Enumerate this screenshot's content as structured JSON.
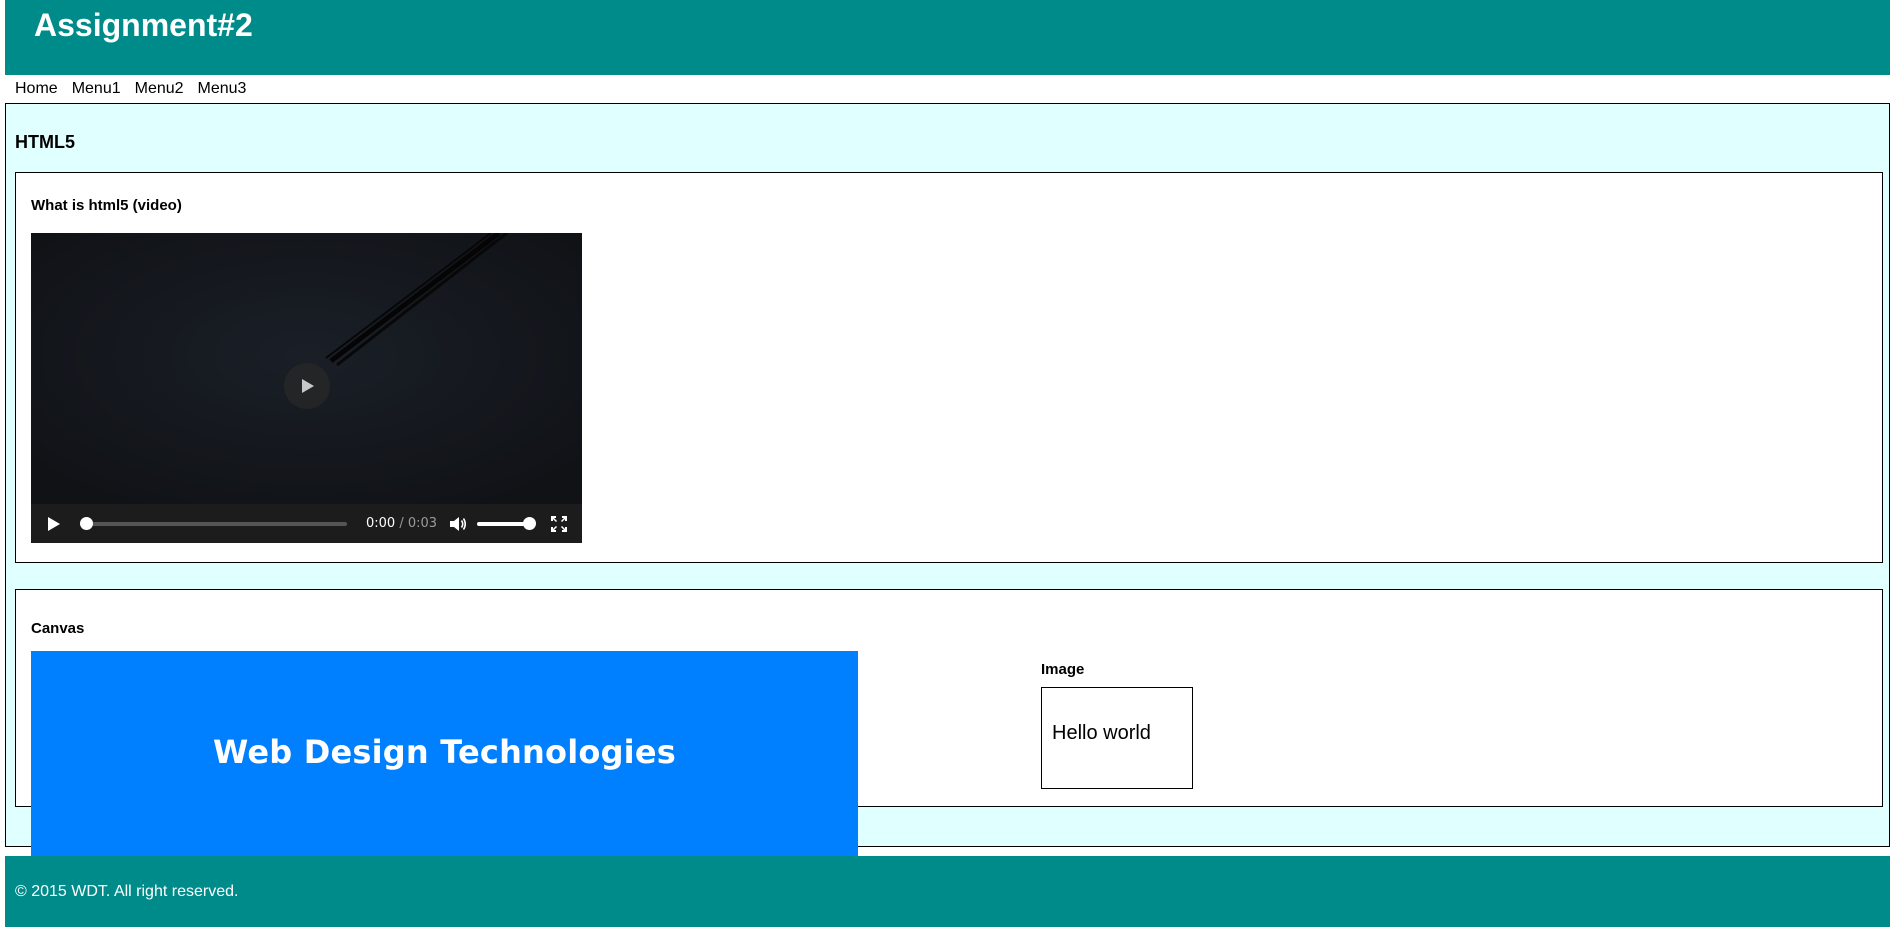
{
  "header": {
    "title": "Assignment#2"
  },
  "nav": {
    "items": [
      "Home",
      "Menu1",
      "Menu2",
      "Menu3"
    ]
  },
  "main": {
    "heading": "HTML5",
    "video_section": {
      "title": "What is html5 (video)",
      "player": {
        "current_time": "0:00",
        "separator": " / ",
        "duration": "0:03",
        "progress": 0,
        "volume": 1.0
      }
    },
    "canvas_section": {
      "title": "Canvas",
      "canvas_text": "Web Design Technologies",
      "canvas_color": "#007fff",
      "image_title": "Image",
      "image_text": "Hello world"
    }
  },
  "footer": {
    "text": "© 2015 WDT. All right reserved."
  },
  "colors": {
    "header_bg": "#008b8b",
    "main_bg": "#e0ffff",
    "footer_bg": "#008b8b"
  }
}
